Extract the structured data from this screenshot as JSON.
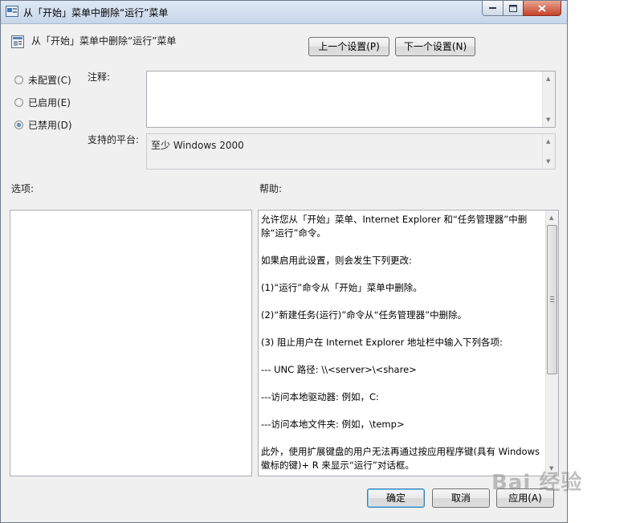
{
  "window": {
    "title": "从「开始」菜单中删除“运行”菜单"
  },
  "policy": {
    "title": "从「开始」菜单中删除“运行”菜单",
    "prev_button": "上一个设置(P)",
    "next_button": "下一个设置(N)"
  },
  "options": {
    "not_configured": "未配置(C)",
    "enabled": "已启用(E)",
    "disabled": "已禁用(D)",
    "selected": "disabled"
  },
  "comment": {
    "label": "注释:",
    "value": ""
  },
  "platform": {
    "label": "支持的平台:",
    "value": "至少 Windows 2000"
  },
  "options_label": "选项:",
  "help": {
    "label": "帮助:",
    "paragraphs": [
      "允许您从「开始」菜单、Internet Explorer 和“任务管理器”中删除“运行”命令。",
      "如果启用此设置，则会发生下列更改:",
      "(1)“运行”命令从「开始」菜单中删除。",
      "(2)“新建任务(运行)”命令从“任务管理器”中删除。",
      "(3) 阻止用户在 Internet Explorer 地址栏中输入下列各项:",
      "--- UNC 路径: \\\\<server>\\<share>",
      "---访问本地驱动器: 例如，C:",
      "---访问本地文件夹: 例如，\\temp>",
      "此外，使用扩展键盘的用户无法再通过按应用程序键(具有 Windows 徽标的键)+ R 来显示“运行”对话框。"
    ]
  },
  "footer": {
    "ok": "确定",
    "cancel": "取消",
    "apply": "应用(A)"
  },
  "watermark": "Bai 经验",
  "colors": {
    "window_bg": "#f0f0f0",
    "close_button": "#c7422a",
    "selected_radio": "#1f4f82"
  }
}
